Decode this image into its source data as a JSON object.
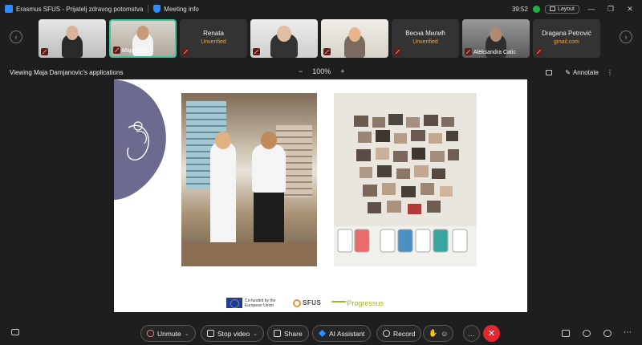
{
  "titlebar": {
    "app_title": "Erasmus SFUS - Prijatelj zdravog potomstva",
    "meeting_info": "Meeting info",
    "timer": "39:52",
    "layout_label": "Layout"
  },
  "participants": [
    {
      "name": "",
      "muted": true
    },
    {
      "name": "Maja Dam...",
      "muted": true,
      "active": true
    },
    {
      "name": "Renata",
      "status": "Unverified",
      "muted": true
    },
    {
      "name": "",
      "muted": true
    },
    {
      "name": "",
      "muted": true
    },
    {
      "name": "Весна Милић",
      "status": "Unverified",
      "muted": true
    },
    {
      "name": "Aleksandra Catic",
      "muted": true
    },
    {
      "name": "Dragana Petrović",
      "status": "gmail.com",
      "muted": true
    }
  ],
  "share": {
    "viewing_label": "Viewing Maja Damjanovic's applications",
    "zoom_minus": "−",
    "zoom_level": "100%",
    "zoom_plus": "+",
    "annotate_label": "Annotate"
  },
  "slide": {
    "eu_logo_text": "Co-funded by the European Union",
    "sfus_logo_text": "SFUS",
    "progressus_logo_text": "Progressus"
  },
  "controls": {
    "unmute": "Unmute",
    "stop_video": "Stop video",
    "share": "Share",
    "ai_assistant": "AI Assistant",
    "record": "Record"
  },
  "colors": {
    "accent": "#3ec7a0",
    "unverified": "#f1a33b",
    "leave": "#e2272e",
    "muted": "#ff6b6b"
  }
}
